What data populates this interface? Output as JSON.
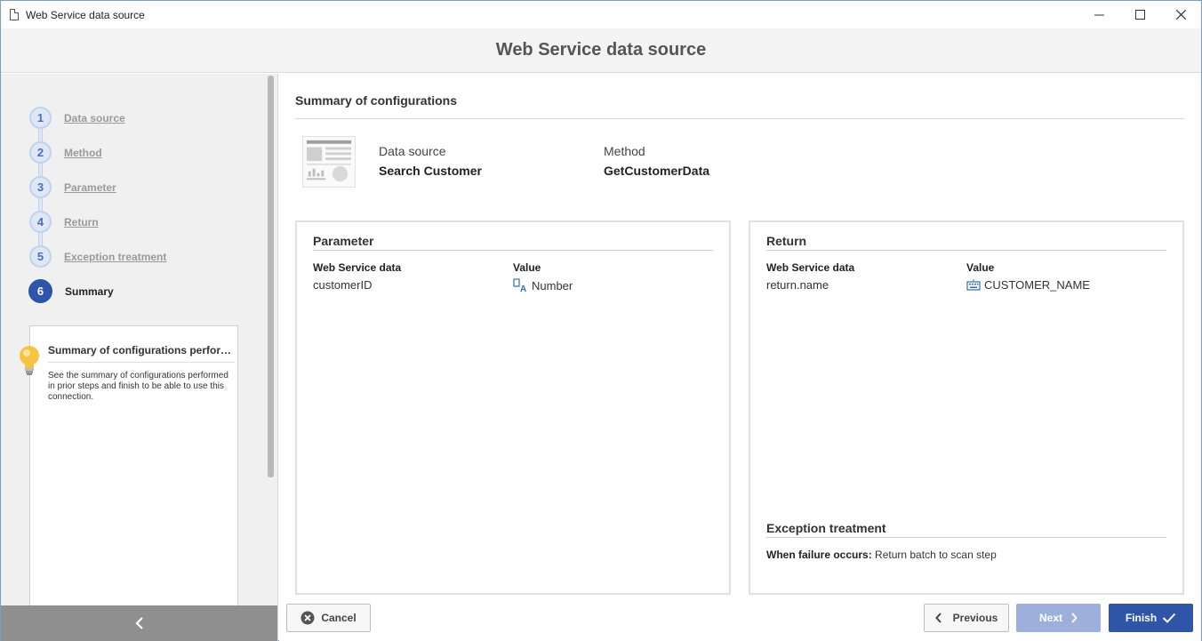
{
  "window": {
    "title": "Web Service data source"
  },
  "header": {
    "title": "Web Service data source"
  },
  "steps": [
    {
      "number": "1",
      "label": "Data source"
    },
    {
      "number": "2",
      "label": "Method"
    },
    {
      "number": "3",
      "label": "Parameter"
    },
    {
      "number": "4",
      "label": "Return"
    },
    {
      "number": "5",
      "label": "Exception treatment"
    },
    {
      "number": "6",
      "label": "Summary"
    }
  ],
  "tip": {
    "title": "Summary of configurations performed",
    "text": "See the summary of configurations performed in prior steps and finish to be able to use this connection."
  },
  "summary": {
    "title": "Summary of configurations",
    "data_source_label": "Data source",
    "data_source_value": "Search Customer",
    "method_label": "Method",
    "method_value": "GetCustomerData"
  },
  "parameter": {
    "title": "Parameter",
    "col1": "Web Service data",
    "col2": "Value",
    "row_data": "customerID",
    "row_value": "Number",
    "value_icon": "field-type-icon"
  },
  "return": {
    "title": "Return",
    "col1": "Web Service data",
    "col2": "Value",
    "row_data": "return.name",
    "row_value": "CUSTOMER_NAME",
    "value_icon": "keyboard-icon"
  },
  "exception": {
    "title": "Exception treatment",
    "label": "When failure occurs:",
    "value": "Return batch to scan step"
  },
  "buttons": {
    "cancel": "Cancel",
    "previous": "Previous",
    "next": "Next",
    "finish": "Finish"
  },
  "colors": {
    "accent": "#2f55a8",
    "disabled": "#9db0dc"
  }
}
